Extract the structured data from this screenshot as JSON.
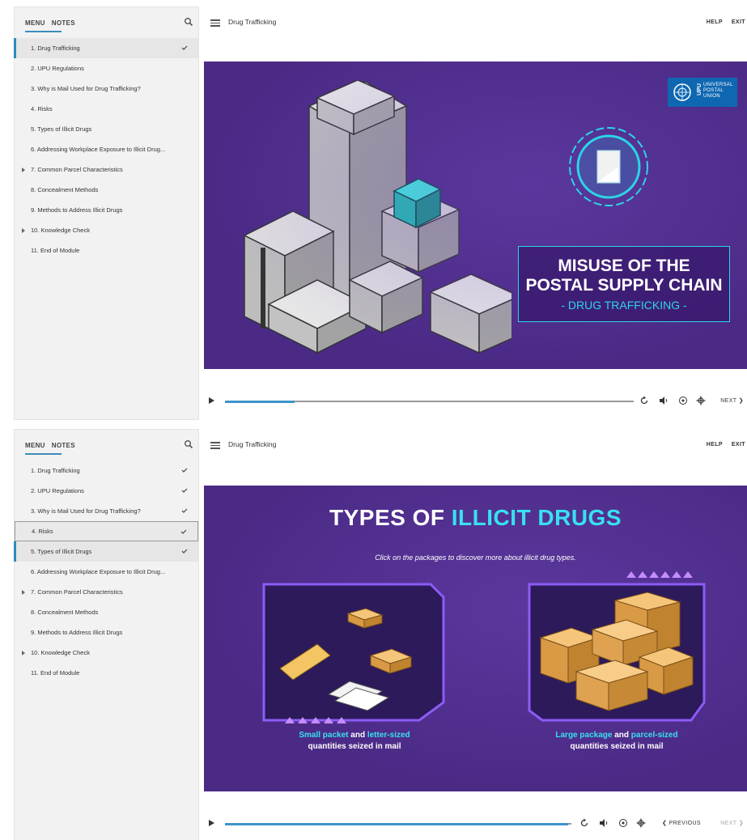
{
  "sidebar": {
    "tab_menu": "MENU",
    "tab_notes": "NOTES",
    "items": [
      "1. Drug Trafficking",
      "2. UPU Regulations",
      "3. Why is Mail Used for Drug Trafficking?",
      "4. Risks",
      "5. Types of Illicit Drugs",
      "6. Addressing Workplace Exposure to Illicit Drug...",
      "7. Common Parcel Characteristics",
      "8. Concealment Methods",
      "9. Methods to Address Illicit Drugs",
      "10. Knowledge Check",
      "11. End of Module"
    ]
  },
  "topbar": {
    "course_title": "Drug Trafficking",
    "help": "HELP",
    "exit": "EXIT"
  },
  "player": {
    "next": "NEXT",
    "previous": "PREVIOUS",
    "progress_top": 0.17,
    "progress_bottom": 0.99
  },
  "slide1": {
    "logo_line1": "UNIVERSAL",
    "logo_line2": "POSTAL",
    "logo_line3": "UNION",
    "logo_abbr": "UPU",
    "title_line1": "MISUSE OF THE",
    "title_line2": "POSTAL SUPPLY CHAIN",
    "title_line3": "- DRUG TRAFFICKING -"
  },
  "slide2": {
    "title_part1": "TYPES OF ",
    "title_part2": "ILLICIT DRUGS",
    "subtitle": "Click on the packages to discover more about illicit drug types.",
    "left_caption_a": "Small packet",
    "left_caption_b": " and ",
    "left_caption_c": "letter-sized",
    "left_caption_d": "quantities seized in mail",
    "right_caption_a": "Large package",
    "right_caption_b": " and ",
    "right_caption_c": "parcel-sized",
    "right_caption_d": "quantities seized in mail"
  },
  "colors": {
    "slide_bg": "#4b2a86",
    "accent_cyan": "#37e1f0",
    "progress_blue": "#3e93c8",
    "upu_blue": "#0f67b1"
  }
}
